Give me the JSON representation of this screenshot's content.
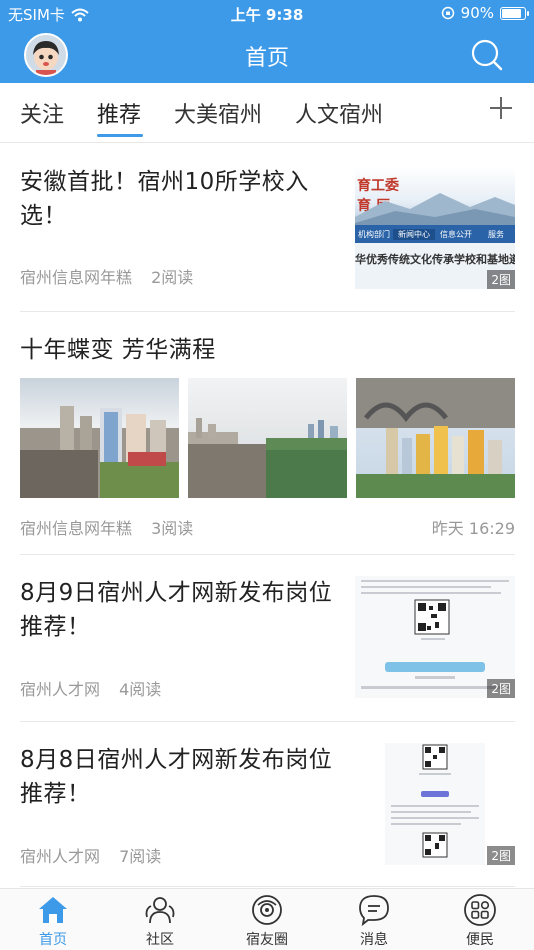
{
  "status_bar": {
    "carrier": "无SIM卡",
    "time": "上午 9:38",
    "battery": "90%",
    "battery_level": 0.9
  },
  "navbar": {
    "title": "首页"
  },
  "tabs": [
    {
      "label": "关注"
    },
    {
      "label": "推荐",
      "active": true
    },
    {
      "label": "大美宿州"
    },
    {
      "label": "人文宿州"
    }
  ],
  "feed": [
    {
      "title": "安徽首批！宿州10所学校入选！",
      "source": "宿州信息网年糕",
      "reads": "2阅读",
      "badge": "2图",
      "thumb_texts": {
        "header": "育工委",
        "header2": "育 厅",
        "nav1": "机构部门",
        "nav2": "新闻中心",
        "nav3": "信息公开",
        "nav4": "服务",
        "caption": "华优秀传统文化传承学校和基地遴"
      }
    },
    {
      "title": "十年蝶变 芳华满程",
      "source": "宿州信息网年糕",
      "reads": "3阅读",
      "time": "昨天 16:29"
    },
    {
      "title": "8月9日宿州人才网新发布岗位推荐！",
      "source": "宿州人才网",
      "reads": "4阅读",
      "badge": "2图"
    },
    {
      "title": "8月8日宿州人才网新发布岗位推荐！",
      "source": "宿州人才网",
      "reads": "7阅读",
      "badge": "2图"
    }
  ],
  "bottom_tabs": [
    {
      "label": "首页",
      "icon": "home-icon",
      "active": true
    },
    {
      "label": "社区",
      "icon": "community-icon"
    },
    {
      "label": "宿友圈",
      "icon": "circle-icon"
    },
    {
      "label": "消息",
      "icon": "message-icon"
    },
    {
      "label": "便民",
      "icon": "services-icon"
    }
  ],
  "colors": {
    "accent": "#3d9ae8",
    "text": "#222222",
    "meta": "#999999"
  }
}
